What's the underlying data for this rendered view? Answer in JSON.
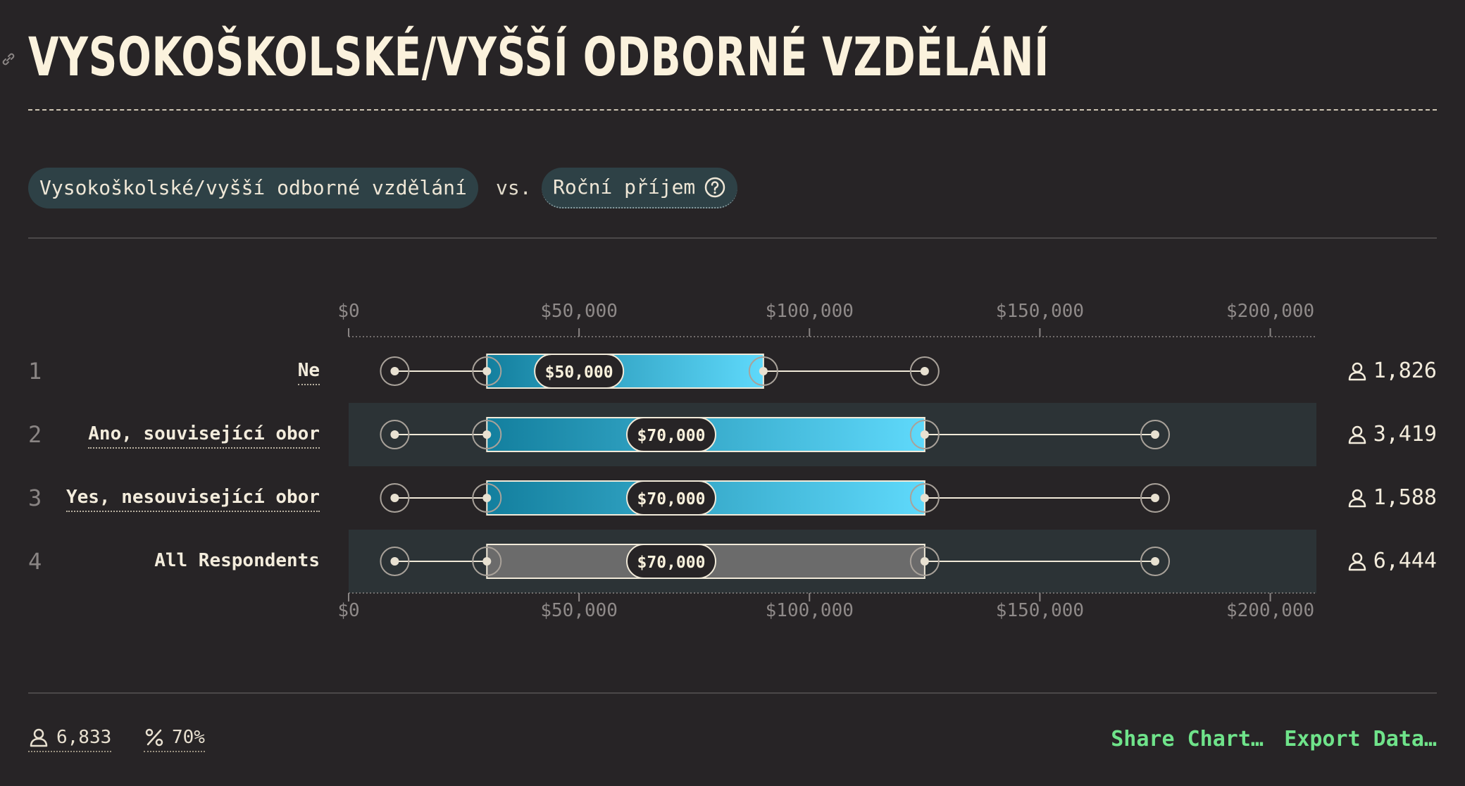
{
  "title": "VYSOKOŠKOLSKÉ/VYŠŠÍ ODBORNÉ VZDĚLÁNÍ",
  "selector": {
    "x_variable": "Vysokoškolské/vyšší odborné vzdělání",
    "vs": "vs.",
    "y_variable": "Roční příjem"
  },
  "chart_data": {
    "type": "boxplot",
    "x_axis": {
      "min": 0,
      "max": 210000,
      "ticks": [
        0,
        50000,
        100000,
        150000,
        200000
      ],
      "tick_labels": [
        "$0",
        "$50,000",
        "$100,000",
        "$150,000",
        "$200,000"
      ]
    },
    "rows": [
      {
        "rank": "1",
        "label": "Ne",
        "whisker_low": 10000,
        "q1": 30000,
        "median": 50000,
        "median_label": "$50,000",
        "q3": 90000,
        "whisker_high": 125000,
        "count": "1,826",
        "style": "accent"
      },
      {
        "rank": "2",
        "label": "Ano, související obor",
        "whisker_low": 10000,
        "q1": 30000,
        "median": 70000,
        "median_label": "$70,000",
        "q3": 125000,
        "whisker_high": 175000,
        "count": "3,419",
        "style": "accent"
      },
      {
        "rank": "3",
        "label": "Yes, nesouvisející obor",
        "whisker_low": 10000,
        "q1": 30000,
        "median": 70000,
        "median_label": "$70,000",
        "q3": 125000,
        "whisker_high": 175000,
        "count": "1,588",
        "style": "accent"
      },
      {
        "rank": "4",
        "label": "All Respondents",
        "whisker_low": 10000,
        "q1": 30000,
        "median": 70000,
        "median_label": "$70,000",
        "q3": 125000,
        "whisker_high": 175000,
        "count": "6,444",
        "style": "neutral"
      }
    ]
  },
  "footer": {
    "respondents": "6,833",
    "percent": "70%",
    "share_label": "Share Chart…",
    "export_label": "Export Data…"
  },
  "colors": {
    "background": "#272426",
    "band": "#2c3336",
    "accent_from": "#137f9e",
    "accent_to": "#5fd9fb",
    "neutral_box": "#6b6b6b",
    "link_green": "#6fe38a"
  },
  "icons": {
    "link": "link-icon",
    "help": "question-circle-icon",
    "person": "person-icon",
    "percent": "percent-icon"
  }
}
